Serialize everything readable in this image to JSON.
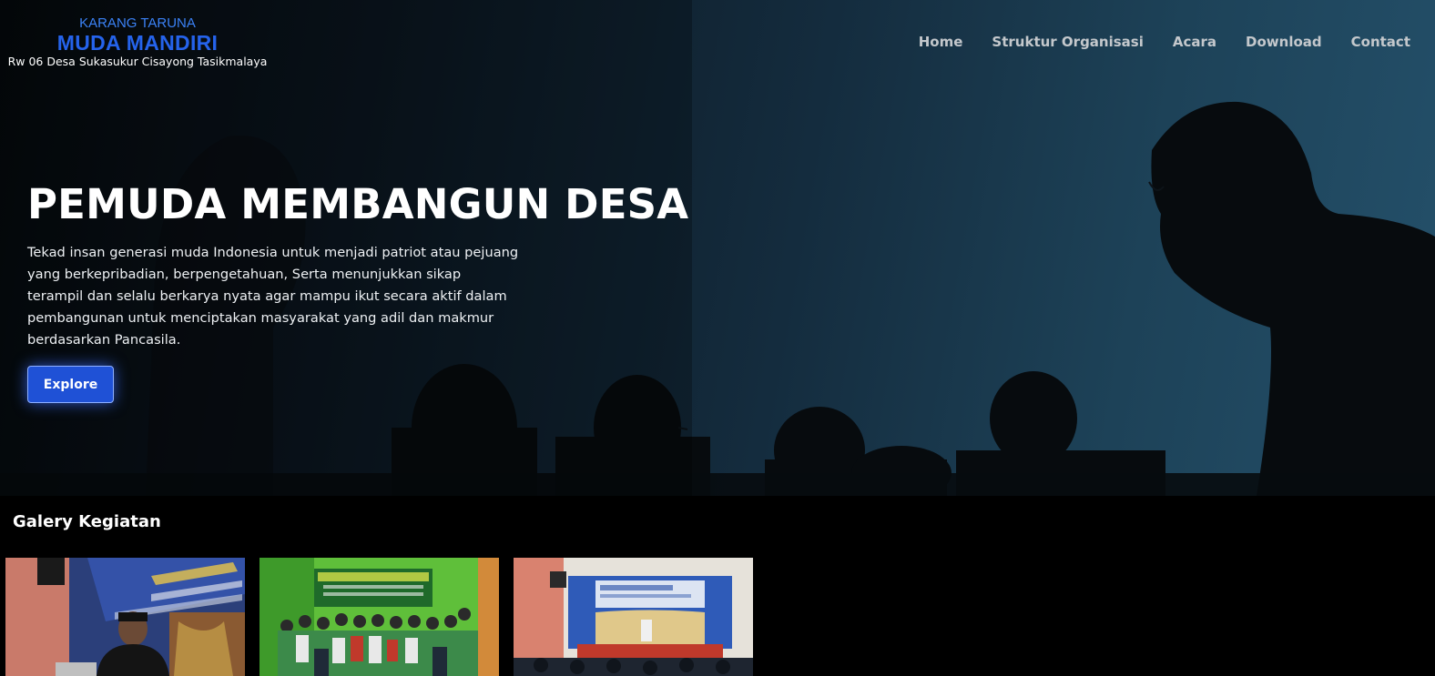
{
  "brand": {
    "subtitle": "KARANG TARUNA",
    "title": "MUDA MANDIRI",
    "location": "Rw 06 Desa Sukasukur Cisayong Tasikmalaya"
  },
  "nav": {
    "items": [
      {
        "label": "Home"
      },
      {
        "label": "Struktur Organisasi"
      },
      {
        "label": "Acara"
      },
      {
        "label": "Download"
      },
      {
        "label": "Contact"
      }
    ]
  },
  "hero": {
    "title": "PEMUDA MEMBANGUN DESA",
    "description": "Tekad insan generasi muda Indonesia untuk menjadi patriot atau pejuang yang berkepribadian, berpengetahuan, Serta menunjukkan sikap terampil dan selalu berkarya nyata agar mampu ikut secara aktif dalam pembangunan untuk menciptakan masyarakat yang adil dan makmur berdasarkan Pancasila.",
    "button_label": "Explore"
  },
  "gallery": {
    "title": "Galery Kegiatan",
    "images": [
      {
        "alt": "activity-photo-1"
      },
      {
        "alt": "activity-photo-2"
      },
      {
        "alt": "activity-photo-3"
      }
    ]
  },
  "colors": {
    "brand_blue": "#2563eb",
    "brand_light_blue": "#3b82f6",
    "button_blue": "#1f51d6",
    "nav_text": "#c4c8cc"
  }
}
